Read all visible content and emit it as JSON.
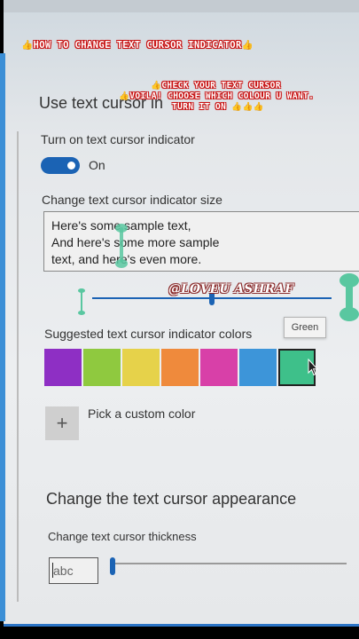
{
  "overlay": {
    "headline": "HOW TO CHANGE TEXT CURSOR INDICATOR",
    "line1": "CHECK YOUR TEXT CURSOR",
    "line2": "VOILA! CHOOSE WHICH COLOUR U WANT.",
    "line3": "TURN IT ON",
    "watermark": "@LOVEU ASHRAF"
  },
  "settings": {
    "section_title": "Use text cursor in",
    "toggle_label": "Turn on text cursor indicator",
    "toggle_state": "On",
    "toggle_on": true,
    "size_label": "Change text cursor indicator size",
    "sample_lines": [
      "Here's some sample text,",
      "And here's some more sample",
      "text, and here's even more."
    ],
    "size_slider_value": 0.5,
    "colors_label": "Suggested text cursor indicator colors",
    "tooltip": "Green",
    "colors": [
      "#8e2fc4",
      "#8fc93f",
      "#e6d24a",
      "#ef8a3c",
      "#d840a8",
      "#3d95d9",
      "#3ec08a"
    ],
    "selected_color_index": 6,
    "custom_color_label": "Pick a custom color",
    "appearance_title": "Change the text cursor appearance",
    "thickness_label": "Change text cursor thickness",
    "thickness_preview": "abc",
    "thickness_slider_value": 0.0
  }
}
